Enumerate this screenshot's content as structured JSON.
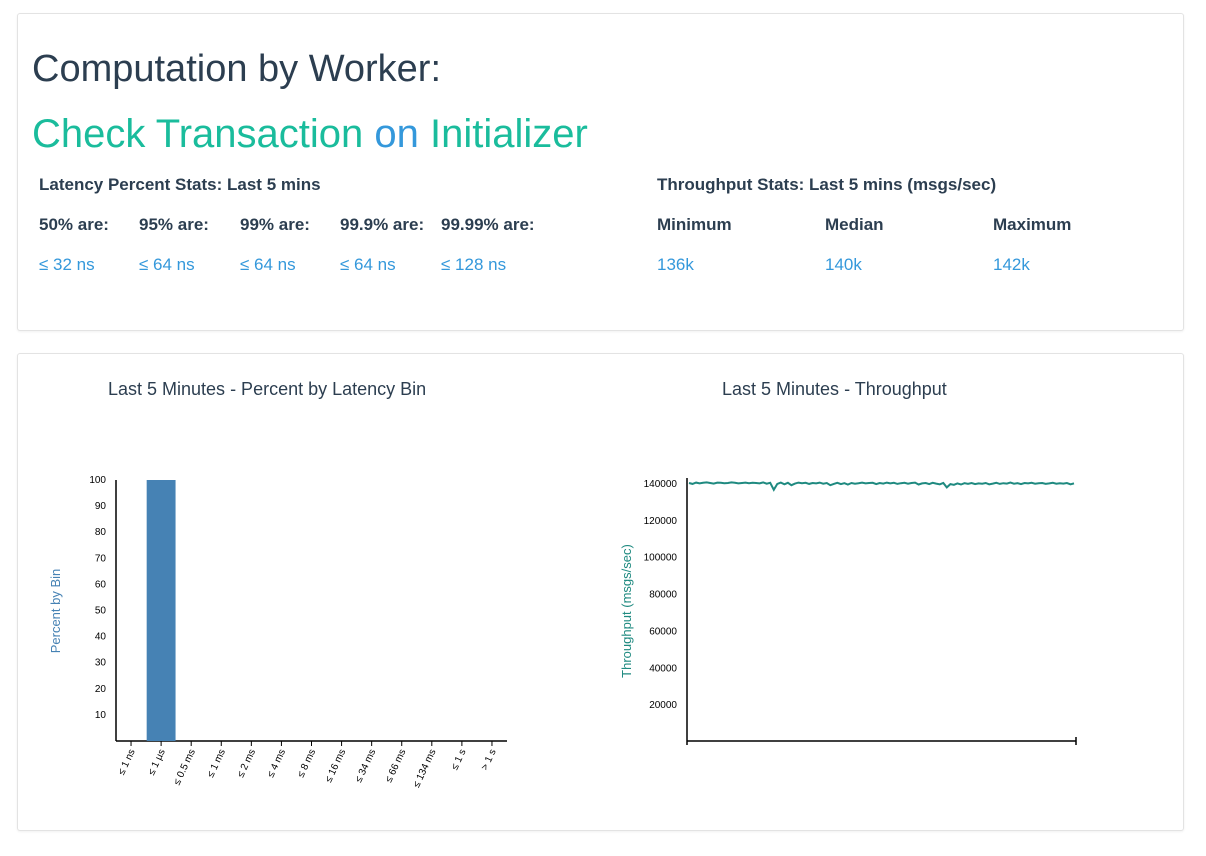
{
  "header": {
    "title": "Computation by Worker:",
    "subtitle_part1": "Check Transaction",
    "subtitle_on": "on",
    "subtitle_part2": "Initializer"
  },
  "latency_stats": {
    "heading": "Latency Percent Stats: Last 5 mins",
    "columns": [
      {
        "label": "50% are:",
        "value": "≤ 32 ns"
      },
      {
        "label": "95% are:",
        "value": "≤ 64 ns"
      },
      {
        "label": "99% are:",
        "value": "≤ 64 ns"
      },
      {
        "label": "99.9% are:",
        "value": "≤ 64 ns"
      },
      {
        "label": "99.99% are:",
        "value": "≤ 128 ns"
      }
    ]
  },
  "throughput_stats": {
    "heading": "Throughput Stats: Last 5 mins (msgs/sec)",
    "columns": [
      {
        "label": "Minimum",
        "value": "136k"
      },
      {
        "label": "Median",
        "value": "140k"
      },
      {
        "label": "Maximum",
        "value": "142k"
      }
    ]
  },
  "colors": {
    "dark_text": "#2c3e50",
    "teal": "#1abc9c",
    "blue": "#3498db",
    "bar": "#4682b4",
    "line": "#1f8a80"
  },
  "chart_data": [
    {
      "type": "bar",
      "title": "Last 5 Minutes - Percent by Latency Bin",
      "ylabel": "Percent by Bin",
      "xlabel": "",
      "ylim": [
        0,
        100
      ],
      "yticks": [
        10,
        20,
        30,
        40,
        50,
        60,
        70,
        80,
        90,
        100
      ],
      "categories": [
        "≤ 1 ns",
        "≤ 1 µs",
        "≤ 0.5 ms",
        "≤ 1 ms",
        "≤ 2 ms",
        "≤ 4 ms",
        "≤ 8 ms",
        "≤ 16 ms",
        "≤ 34 ms",
        "≤ 66 ms",
        "≤ 134 ms",
        "≤ 1 s",
        "> 1 s"
      ],
      "values": [
        0,
        100,
        0,
        0,
        0,
        0,
        0,
        0,
        0,
        0,
        0,
        0,
        0
      ]
    },
    {
      "type": "line",
      "title": "Last 5 Minutes - Throughput",
      "ylabel": "Throughput (msgs/sec)",
      "xlabel": "",
      "ylim": [
        0,
        140000
      ],
      "yticks": [
        20000,
        40000,
        60000,
        80000,
        100000,
        120000,
        140000
      ],
      "values": [
        140000,
        139500,
        140200,
        139800,
        140100,
        140300,
        140000,
        139700,
        140200,
        140100,
        139900,
        140000,
        140300,
        140100,
        139800,
        140000,
        140200,
        139900,
        140100,
        140000,
        139800,
        140300,
        139600,
        140100,
        136300,
        139500,
        140200,
        139300,
        140100,
        138800,
        139700,
        140200,
        139900,
        140100,
        139500,
        140000,
        139800,
        140200,
        139600,
        140000,
        138800,
        139500,
        140100,
        139400,
        139900,
        139200,
        140000,
        139600,
        139900,
        140200,
        139800,
        140000,
        140100,
        139400,
        140000,
        139700,
        140200,
        139800,
        140100,
        139500,
        139900,
        140100,
        139600,
        140000,
        140200,
        139200,
        139800,
        140000,
        139400,
        140100,
        139700,
        139300,
        140000,
        137600,
        139400,
        139000,
        139800,
        139200,
        139900,
        139500,
        140000,
        139400,
        139800,
        139600,
        140000,
        139300,
        139700,
        140100,
        139500,
        139900,
        139700,
        140200,
        139600,
        139900,
        139400,
        140000,
        139800,
        140100,
        139600,
        139900,
        140000,
        139500,
        139800,
        140100,
        139600,
        139900,
        139700,
        140000,
        139300,
        139800
      ]
    }
  ]
}
